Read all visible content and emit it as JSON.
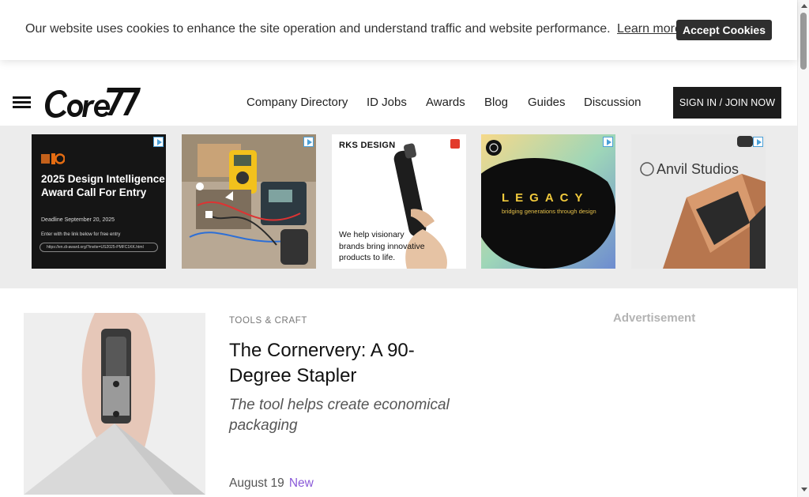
{
  "cookie": {
    "message": "Our website uses cookies to enhance the site operation and understand traffic and website performance.",
    "learn_more": "Learn more.",
    "accept_label": "Accept Cookies"
  },
  "header": {
    "menu_icon": "hamburger-menu-icon",
    "logo_text": "Core77",
    "nav": [
      {
        "label": "Company Directory"
      },
      {
        "label": "ID Jobs"
      },
      {
        "label": "Awards"
      },
      {
        "label": "Blog"
      },
      {
        "label": "Guides"
      },
      {
        "label": "Discussion"
      }
    ],
    "signin_label": "SIGN IN / JOIN NOW"
  },
  "ads": {
    "ad1": {
      "title": "2025 Design Intelligence Award Call For Entry",
      "deadline": "Deadline September 20, 2025",
      "note": "Enter with the link below for free entry",
      "link": "https://en.di-award.org/?invite=US2025-PMFC1KK.html"
    },
    "ad3": {
      "brand": "RKS DESIGN",
      "tagline": "We help visionary brands bring innovative products to life."
    },
    "ad4": {
      "brand": "LEGACY",
      "tagline": "bridging generations through design"
    },
    "ad5": {
      "brand": "Anvil Studios"
    }
  },
  "article": {
    "category": "TOOLS & CRAFT",
    "title": "The Cornervery: A 90-Degree Stapler",
    "subtitle": "The tool helps create economical packaging",
    "date": "August 19",
    "badge": "New"
  },
  "sidebar": {
    "ad_label": "Advertisement"
  },
  "colors": {
    "accent_new": "#8a5ad8",
    "button_dark": "#1c1c1c",
    "ad_strip_bg": "#ececec"
  }
}
